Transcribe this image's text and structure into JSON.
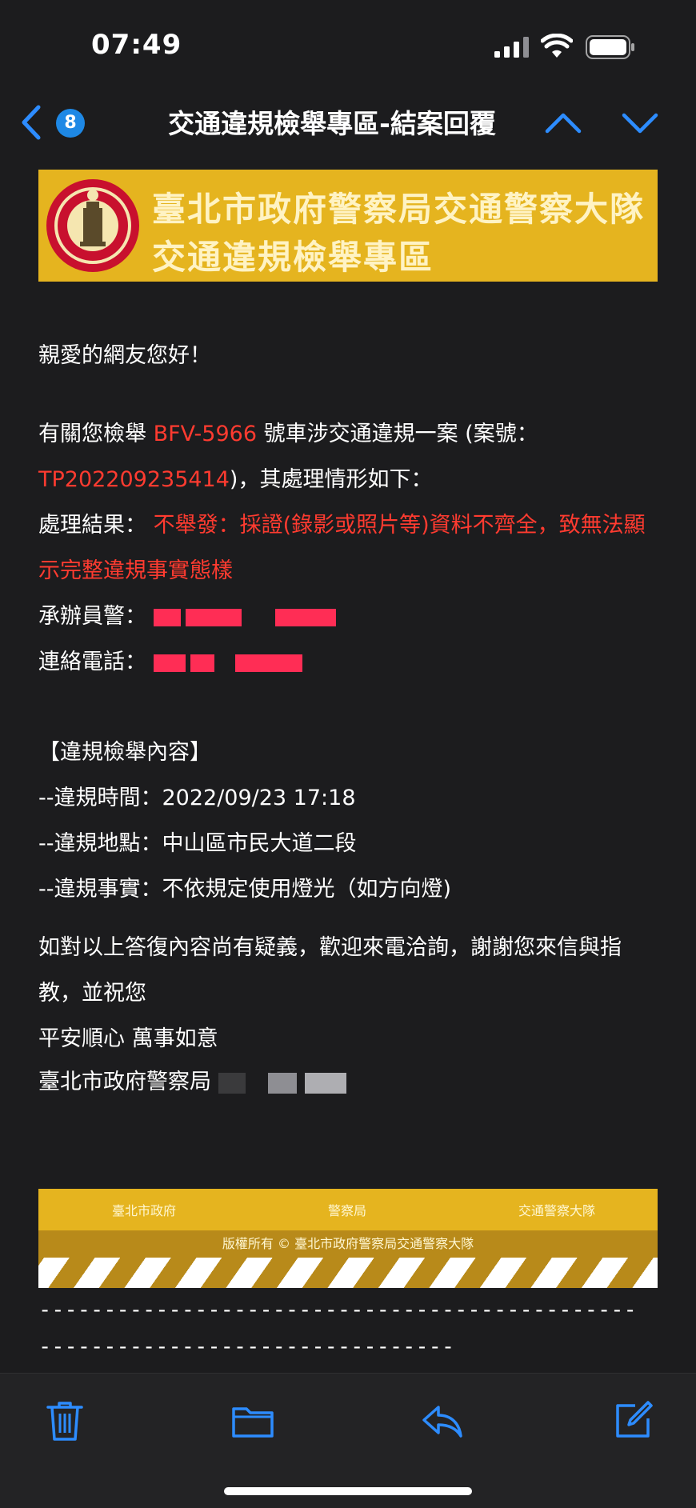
{
  "status_bar": {
    "time": "07:49"
  },
  "nav": {
    "unread_count": "8",
    "title": "交通違規檢舉專區-結案回覆"
  },
  "banner": {
    "line1": "臺北市政府警察局交通警察大隊",
    "line2": "交通違規檢舉專區"
  },
  "body": {
    "greeting": "親愛的網友您好！",
    "intro_prefix": "有關您檢舉",
    "plate": "BFV-5966",
    "intro_suffix": "號車涉交通違規一案 (案號：",
    "case_no": "TP202209235414",
    "intro_tail": ")，其處理情形如下：",
    "result_label": "處理結果：",
    "result_text": "不舉發：採證(錄影或照片等)資料不齊全，致無法顯示完整違規事實態樣",
    "officer_label": "承辦員警：",
    "phone_label": "連絡電話：",
    "section_title": "【違規檢舉內容】",
    "time_line": "--違規時間：2022/09/23 17:18",
    "place_line": "--違規地點：中山區市民大道二段",
    "fact_line": "--違規事實：不依規定使用燈光（如方向燈)",
    "closing1": "如對以上答復內容尚有疑義，歡迎來電洽詢，謝謝您來信與指教，並祝您",
    "closing2": "平安順心 萬事如意",
    "signature": "臺北市政府警察局"
  },
  "footer": {
    "link1": "臺北市政府",
    "link2": "警察局",
    "link3": "交通警察大隊",
    "copyright": "版權所有 © 臺北市政府警察局交通警察大隊"
  },
  "separator": {
    "line1": "----------------------------------------------",
    "line2": "--------------------------------"
  },
  "toolbar": {
    "icons": [
      "trash-icon",
      "folder-icon",
      "reply-icon",
      "compose-icon"
    ],
    "accent": "#2d8cff"
  },
  "colors": {
    "banner_yellow": "#e5b41f",
    "alert_red": "#ff3b30",
    "badge_blue": "#1e88e5"
  }
}
